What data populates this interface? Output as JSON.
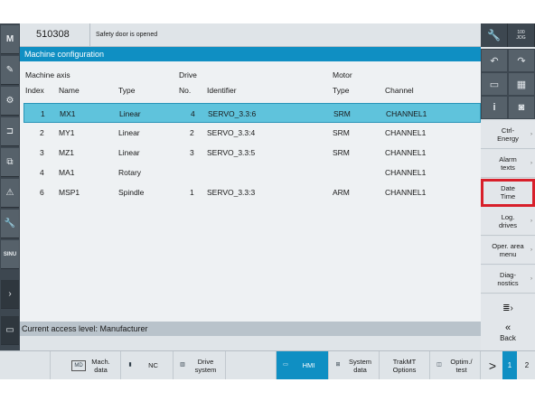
{
  "header": {
    "code": "510308",
    "message": "Safety door is opened"
  },
  "title": "Machine configuration",
  "table": {
    "group_headers": {
      "machine_axis": "Machine axis",
      "drive": "Drive",
      "motor": "Motor"
    },
    "columns": {
      "index": "Index",
      "name": "Name",
      "type": "Type",
      "drive_no": "No.",
      "identifier": "Identifier",
      "motor_type": "Type",
      "channel": "Channel"
    },
    "rows": [
      {
        "index": "1",
        "name": "MX1",
        "type": "Linear",
        "drive_no": "4",
        "identifier": "SERVO_3.3:6",
        "motor_type": "SRM",
        "channel": "CHANNEL1"
      },
      {
        "index": "2",
        "name": "MY1",
        "type": "Linear",
        "drive_no": "2",
        "identifier": "SERVO_3.3:4",
        "motor_type": "SRM",
        "channel": "CHANNEL1"
      },
      {
        "index": "3",
        "name": "MZ1",
        "type": "Linear",
        "drive_no": "3",
        "identifier": "SERVO_3.3:5",
        "motor_type": "SRM",
        "channel": "CHANNEL1"
      },
      {
        "index": "4",
        "name": "MA1",
        "type": "Rotary",
        "drive_no": "",
        "identifier": "",
        "motor_type": "",
        "channel": "CHANNEL1"
      },
      {
        "index": "6",
        "name": "MSP1",
        "type": "Spindle",
        "drive_no": "1",
        "identifier": "SERVO_3.3:3",
        "motor_type": "ARM",
        "channel": "CHANNEL1"
      }
    ]
  },
  "status": "Current access level: Manufacturer",
  "right_top": {
    "tool_icon": "wrench-icon",
    "right_label_1": "100",
    "right_label_2": "JOG"
  },
  "softkeys_right": [
    {
      "label": "Ctrl-\nEnergy"
    },
    {
      "label": "Alarm\ntexts"
    },
    {
      "label": "Date\nTime"
    },
    {
      "label": "Log.\ndrives"
    },
    {
      "label": "Oper. area\nmenu"
    },
    {
      "label": "Diag-\nnostics"
    }
  ],
  "back_label": "Back",
  "softkeys_bottom": [
    {
      "label": "Mach.\ndata",
      "icon": "MD"
    },
    {
      "label": "NC",
      "icon": ""
    },
    {
      "label": "Drive\nsystem",
      "icon": ""
    },
    {
      "label": "HMI",
      "icon": ""
    },
    {
      "label": "System\ndata",
      "icon": ""
    },
    {
      "label": "TrakMT\nOptions",
      "icon": ""
    },
    {
      "label": "Optim./\ntest",
      "icon": ""
    }
  ],
  "pages": {
    "next": ">",
    "page1": "1",
    "page2": "2"
  },
  "left_keys": [
    "M",
    "",
    "",
    "",
    "",
    "",
    "",
    "SINU",
    "",
    "",
    ""
  ],
  "colors": {
    "accent": "#0f8fc3",
    "selected_row": "#5fc3dc",
    "highlight": "#d81f2a"
  }
}
